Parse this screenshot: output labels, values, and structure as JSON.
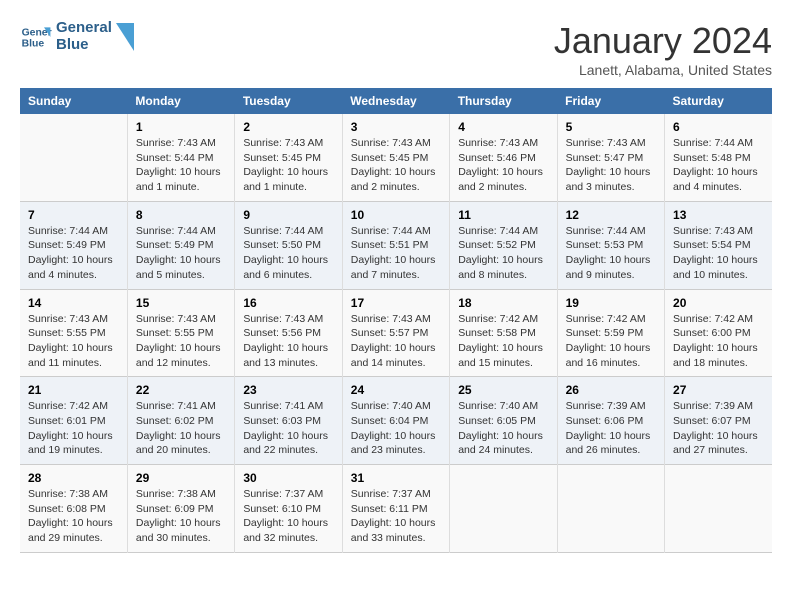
{
  "header": {
    "logo_line1": "General",
    "logo_line2": "Blue",
    "main_title": "January 2024",
    "sub_title": "Lanett, Alabama, United States"
  },
  "weekdays": [
    "Sunday",
    "Monday",
    "Tuesday",
    "Wednesday",
    "Thursday",
    "Friday",
    "Saturday"
  ],
  "weeks": [
    [
      {
        "day": "",
        "info": ""
      },
      {
        "day": "1",
        "info": "Sunrise: 7:43 AM\nSunset: 5:44 PM\nDaylight: 10 hours\nand 1 minute."
      },
      {
        "day": "2",
        "info": "Sunrise: 7:43 AM\nSunset: 5:45 PM\nDaylight: 10 hours\nand 1 minute."
      },
      {
        "day": "3",
        "info": "Sunrise: 7:43 AM\nSunset: 5:45 PM\nDaylight: 10 hours\nand 2 minutes."
      },
      {
        "day": "4",
        "info": "Sunrise: 7:43 AM\nSunset: 5:46 PM\nDaylight: 10 hours\nand 2 minutes."
      },
      {
        "day": "5",
        "info": "Sunrise: 7:43 AM\nSunset: 5:47 PM\nDaylight: 10 hours\nand 3 minutes."
      },
      {
        "day": "6",
        "info": "Sunrise: 7:44 AM\nSunset: 5:48 PM\nDaylight: 10 hours\nand 4 minutes."
      }
    ],
    [
      {
        "day": "7",
        "info": "Sunrise: 7:44 AM\nSunset: 5:49 PM\nDaylight: 10 hours\nand 4 minutes."
      },
      {
        "day": "8",
        "info": "Sunrise: 7:44 AM\nSunset: 5:49 PM\nDaylight: 10 hours\nand 5 minutes."
      },
      {
        "day": "9",
        "info": "Sunrise: 7:44 AM\nSunset: 5:50 PM\nDaylight: 10 hours\nand 6 minutes."
      },
      {
        "day": "10",
        "info": "Sunrise: 7:44 AM\nSunset: 5:51 PM\nDaylight: 10 hours\nand 7 minutes."
      },
      {
        "day": "11",
        "info": "Sunrise: 7:44 AM\nSunset: 5:52 PM\nDaylight: 10 hours\nand 8 minutes."
      },
      {
        "day": "12",
        "info": "Sunrise: 7:44 AM\nSunset: 5:53 PM\nDaylight: 10 hours\nand 9 minutes."
      },
      {
        "day": "13",
        "info": "Sunrise: 7:43 AM\nSunset: 5:54 PM\nDaylight: 10 hours\nand 10 minutes."
      }
    ],
    [
      {
        "day": "14",
        "info": "Sunrise: 7:43 AM\nSunset: 5:55 PM\nDaylight: 10 hours\nand 11 minutes."
      },
      {
        "day": "15",
        "info": "Sunrise: 7:43 AM\nSunset: 5:55 PM\nDaylight: 10 hours\nand 12 minutes."
      },
      {
        "day": "16",
        "info": "Sunrise: 7:43 AM\nSunset: 5:56 PM\nDaylight: 10 hours\nand 13 minutes."
      },
      {
        "day": "17",
        "info": "Sunrise: 7:43 AM\nSunset: 5:57 PM\nDaylight: 10 hours\nand 14 minutes."
      },
      {
        "day": "18",
        "info": "Sunrise: 7:42 AM\nSunset: 5:58 PM\nDaylight: 10 hours\nand 15 minutes."
      },
      {
        "day": "19",
        "info": "Sunrise: 7:42 AM\nSunset: 5:59 PM\nDaylight: 10 hours\nand 16 minutes."
      },
      {
        "day": "20",
        "info": "Sunrise: 7:42 AM\nSunset: 6:00 PM\nDaylight: 10 hours\nand 18 minutes."
      }
    ],
    [
      {
        "day": "21",
        "info": "Sunrise: 7:42 AM\nSunset: 6:01 PM\nDaylight: 10 hours\nand 19 minutes."
      },
      {
        "day": "22",
        "info": "Sunrise: 7:41 AM\nSunset: 6:02 PM\nDaylight: 10 hours\nand 20 minutes."
      },
      {
        "day": "23",
        "info": "Sunrise: 7:41 AM\nSunset: 6:03 PM\nDaylight: 10 hours\nand 22 minutes."
      },
      {
        "day": "24",
        "info": "Sunrise: 7:40 AM\nSunset: 6:04 PM\nDaylight: 10 hours\nand 23 minutes."
      },
      {
        "day": "25",
        "info": "Sunrise: 7:40 AM\nSunset: 6:05 PM\nDaylight: 10 hours\nand 24 minutes."
      },
      {
        "day": "26",
        "info": "Sunrise: 7:39 AM\nSunset: 6:06 PM\nDaylight: 10 hours\nand 26 minutes."
      },
      {
        "day": "27",
        "info": "Sunrise: 7:39 AM\nSunset: 6:07 PM\nDaylight: 10 hours\nand 27 minutes."
      }
    ],
    [
      {
        "day": "28",
        "info": "Sunrise: 7:38 AM\nSunset: 6:08 PM\nDaylight: 10 hours\nand 29 minutes."
      },
      {
        "day": "29",
        "info": "Sunrise: 7:38 AM\nSunset: 6:09 PM\nDaylight: 10 hours\nand 30 minutes."
      },
      {
        "day": "30",
        "info": "Sunrise: 7:37 AM\nSunset: 6:10 PM\nDaylight: 10 hours\nand 32 minutes."
      },
      {
        "day": "31",
        "info": "Sunrise: 7:37 AM\nSunset: 6:11 PM\nDaylight: 10 hours\nand 33 minutes."
      },
      {
        "day": "",
        "info": ""
      },
      {
        "day": "",
        "info": ""
      },
      {
        "day": "",
        "info": ""
      }
    ]
  ]
}
